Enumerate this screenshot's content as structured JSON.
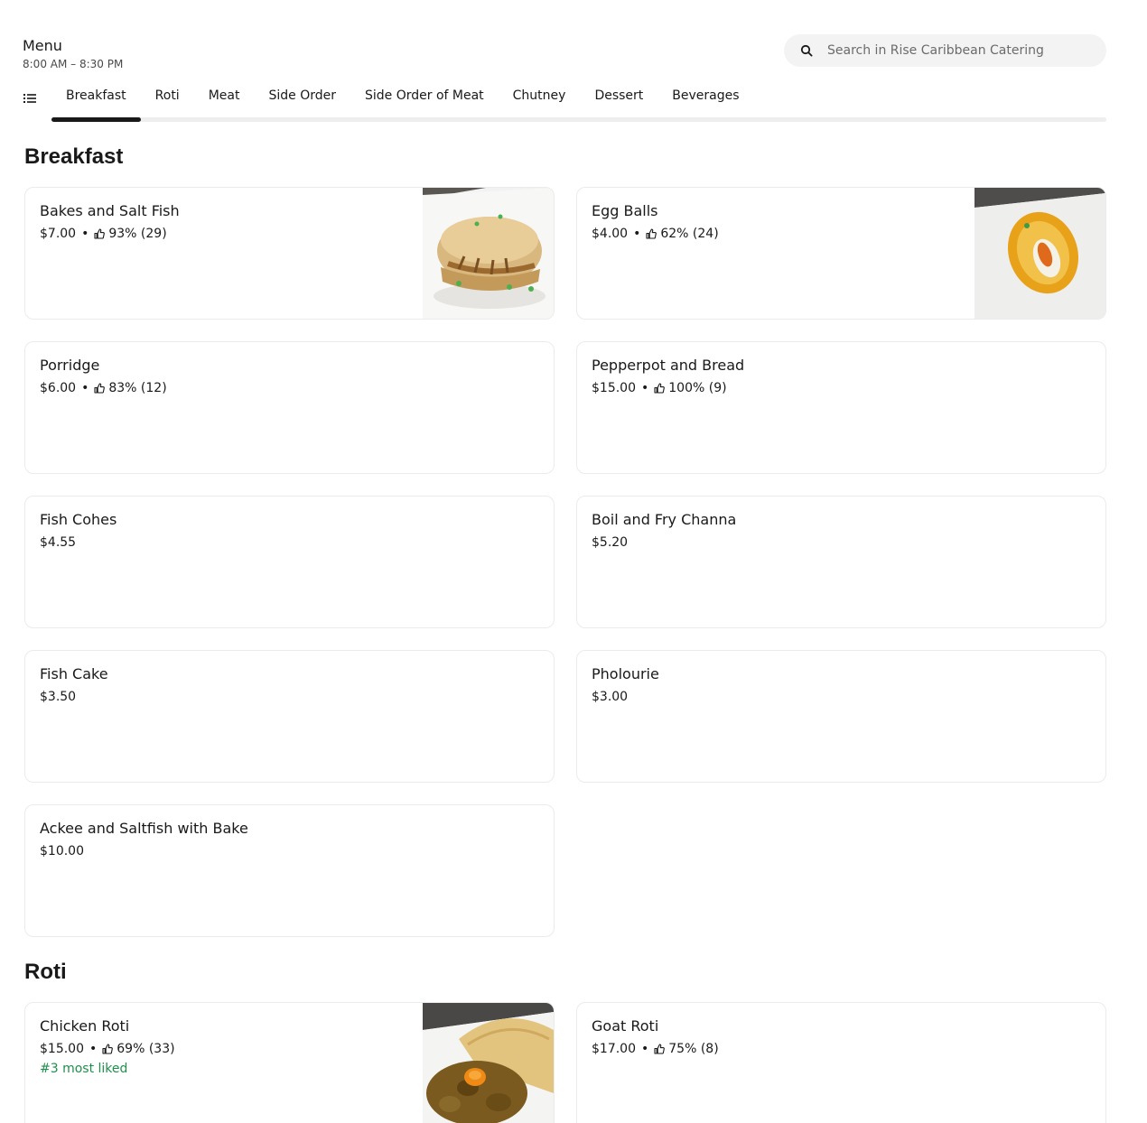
{
  "header": {
    "title": "Menu",
    "hours": "8:00 AM – 8:30 PM"
  },
  "search": {
    "placeholder": "Search in Rise Caribbean Catering",
    "value": ""
  },
  "tabs": [
    "Breakfast",
    "Roti",
    "Meat",
    "Side Order",
    "Side Order of Meat",
    "Chutney",
    "Dessert",
    "Beverages"
  ],
  "active_tab": "Breakfast",
  "sections": {
    "breakfast": {
      "title": "Breakfast",
      "items": [
        {
          "name": "Bakes and Salt Fish",
          "price": "$7.00",
          "rating": "93% (29)",
          "image": "bakes-and-salt-fish"
        },
        {
          "name": "Egg Balls",
          "price": "$4.00",
          "rating": "62% (24)",
          "image": "egg-balls"
        },
        {
          "name": "Porridge",
          "price": "$6.00",
          "rating": "83% (12)"
        },
        {
          "name": "Pepperpot and Bread",
          "price": "$15.00",
          "rating": "100% (9)"
        },
        {
          "name": "Fish Cohes",
          "price": "$4.55"
        },
        {
          "name": "Boil and Fry Channa",
          "price": "$5.20"
        },
        {
          "name": "Fish Cake",
          "price": "$3.50"
        },
        {
          "name": "Pholourie",
          "price": "$3.00"
        },
        {
          "name": "Ackee and Saltfish with Bake",
          "price": "$10.00"
        }
      ]
    },
    "roti": {
      "title": "Roti",
      "items": [
        {
          "name": "Chicken Roti",
          "price": "$15.00",
          "rating": "69% (33)",
          "badge": "#3 most liked",
          "image": "chicken-roti"
        },
        {
          "name": "Goat Roti",
          "price": "$17.00",
          "rating": "75% (8)"
        }
      ]
    }
  },
  "colors": {
    "text": "#191919",
    "muted": "#494949",
    "border": "#ebebeb",
    "search_bg": "#f3f3f3",
    "badge_green": "#1e8f4b"
  },
  "icons": {
    "search": "search-icon",
    "tab_list": "list-icon",
    "rating": "thumbs-up-icon"
  },
  "separator": "•"
}
